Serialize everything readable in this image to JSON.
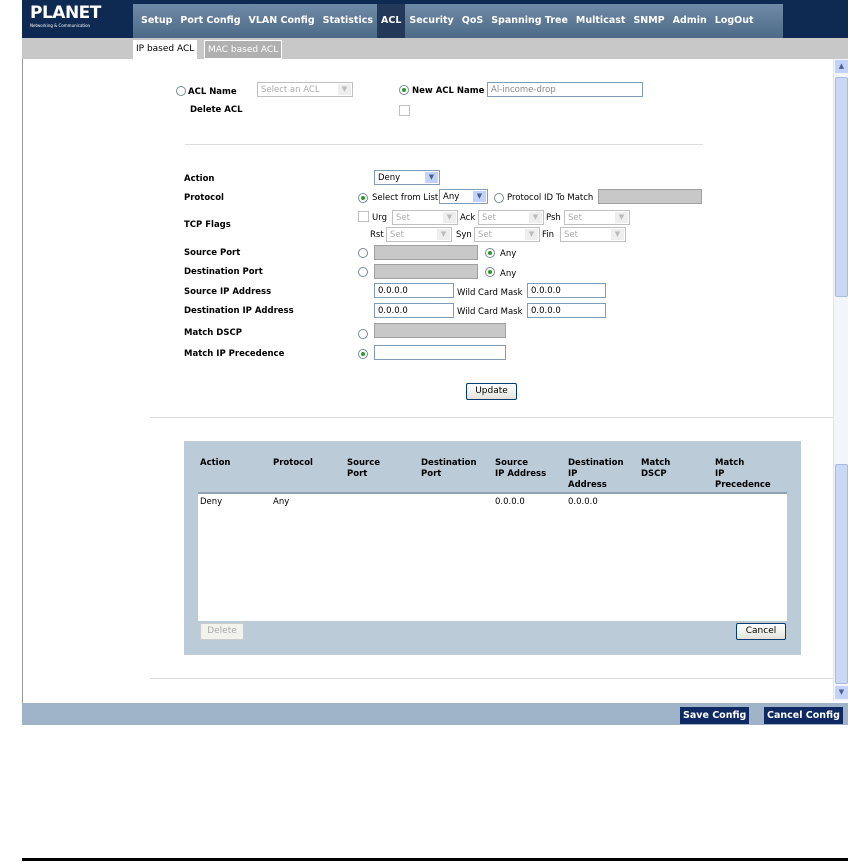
{
  "brand": {
    "name": "PLANET",
    "tagline": "Networking & Communication"
  },
  "nav": [
    "Setup",
    "Port Config",
    "VLAN Config",
    "Statistics",
    "ACL",
    "Security",
    "QoS",
    "Spanning Tree",
    "Multicast",
    "SNMP",
    "Admin",
    "LogOut"
  ],
  "nav_active": "ACL",
  "subnav": [
    "IP based ACL",
    "MAC based ACL"
  ],
  "acl": {
    "acl_name_label": "ACL Name",
    "acl_select": "Select an ACL",
    "new_acl_label": "New ACL Name",
    "new_acl_value": "Al-income-drop",
    "delete_label": "Delete ACL"
  },
  "form": {
    "action_label": "Action",
    "action_value": "Deny",
    "protocol_label": "Protocol",
    "select_from_list": "Select from List",
    "protocol_value": "Any",
    "protocol_id_label": "Protocol ID To Match",
    "tcp_flags_label": "TCP Flags",
    "flags": [
      {
        "name": "Urg",
        "value": "Set"
      },
      {
        "name": "Ack",
        "value": "Set"
      },
      {
        "name": "Psh",
        "value": "Set"
      },
      {
        "name": "Rst",
        "value": "Set"
      },
      {
        "name": "Syn",
        "value": "Set"
      },
      {
        "name": "Fin",
        "value": "Set"
      }
    ],
    "source_port_label": "Source Port",
    "dest_port_label": "Destination Port",
    "any": "Any",
    "source_ip_label": "Source IP Address",
    "source_ip": "0.0.0.0",
    "source_mask": "0.0.0.0",
    "dest_ip_label": "Destination IP Address",
    "dest_ip": "0.0.0.0",
    "dest_mask": "0.0.0.0",
    "wildcard_label": "Wild Card Mask",
    "dscp_label": "Match DSCP",
    "precedence_label": "Match IP Precedence",
    "update": "Update"
  },
  "table": {
    "headers": [
      [
        "Action"
      ],
      [
        "Protocol"
      ],
      [
        "Source",
        "Port"
      ],
      [
        "Destination",
        "Port"
      ],
      [
        "Source",
        "IP Address"
      ],
      [
        "Destination",
        "IP",
        "Address"
      ],
      [
        "Match",
        "DSCP"
      ],
      [
        "Match",
        "IP",
        "Precedence"
      ]
    ],
    "rows": [
      [
        "Deny",
        "Any",
        "",
        "",
        "0.0.0.0",
        "0.0.0.0",
        "",
        ""
      ]
    ],
    "delete": "Delete",
    "cancel": "Cancel"
  },
  "footer": {
    "save": "Save Config",
    "cancel": "Cancel Config"
  }
}
